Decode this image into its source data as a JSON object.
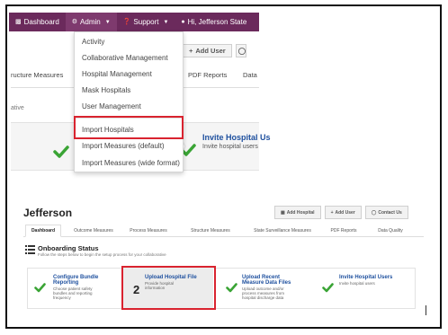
{
  "topnav": {
    "dashboard": "Dashboard",
    "admin": "Admin",
    "support": "Support",
    "user": "Hi, Jefferson State"
  },
  "admin_menu": {
    "items": [
      "Activity",
      "Collaborative Management",
      "Hospital Management",
      "Mask Hospitals",
      "User Management",
      "Import Hospitals",
      "Import Measures (default)",
      "Import Measures (wide format)"
    ],
    "highlighted": "Import Hospitals"
  },
  "background": {
    "add_user": "Add User",
    "tabs": [
      "ructure Measures",
      "PDF Reports",
      "Data"
    ],
    "collab_fragment": "ative",
    "invite_title": "Invite Hospital Us",
    "invite_sub": "Invite hospital users"
  },
  "page": {
    "title": "Jefferson",
    "actions": {
      "add_hospital": "Add Hospital",
      "add_user": "Add User",
      "contact_us": "Contact Us"
    },
    "tabs": [
      "Dashboard",
      "Outcome Measures",
      "Process Measures",
      "Structure Measures",
      "State Surveillance Measures",
      "PDF Reports",
      "Data Quality"
    ],
    "active_tab": "Dashboard"
  },
  "onboarding": {
    "title": "Onboarding Status",
    "subtitle": "Follow the steps below to begin the setup process for your collaborative",
    "steps": [
      {
        "title_1": "Configure Bundle",
        "title_2": "Reporting",
        "sub_1": "Choose patient safety",
        "sub_2": "bundles and reporting",
        "sub_3": "frequency",
        "status": "complete"
      },
      {
        "number": "2",
        "title_1": "Upload Hospital File",
        "sub_1": "Provide hospital",
        "sub_2": "information",
        "status": "current"
      },
      {
        "title_1": "Upload Recent",
        "title_2": "Measure Data Files",
        "sub_1": "Upload outcome and/or",
        "sub_2": "process measures from",
        "sub_3": "hospital discharge data",
        "status": "complete"
      },
      {
        "title_1": "Invite Hospital Users",
        "sub_1": "Invite hospital users",
        "status": "complete"
      }
    ]
  },
  "colors": {
    "nav_purple": "#6b2a5c",
    "link_blue": "#1d4f9e",
    "check_green": "#3aa435",
    "highlight_red": "#d9232f"
  }
}
